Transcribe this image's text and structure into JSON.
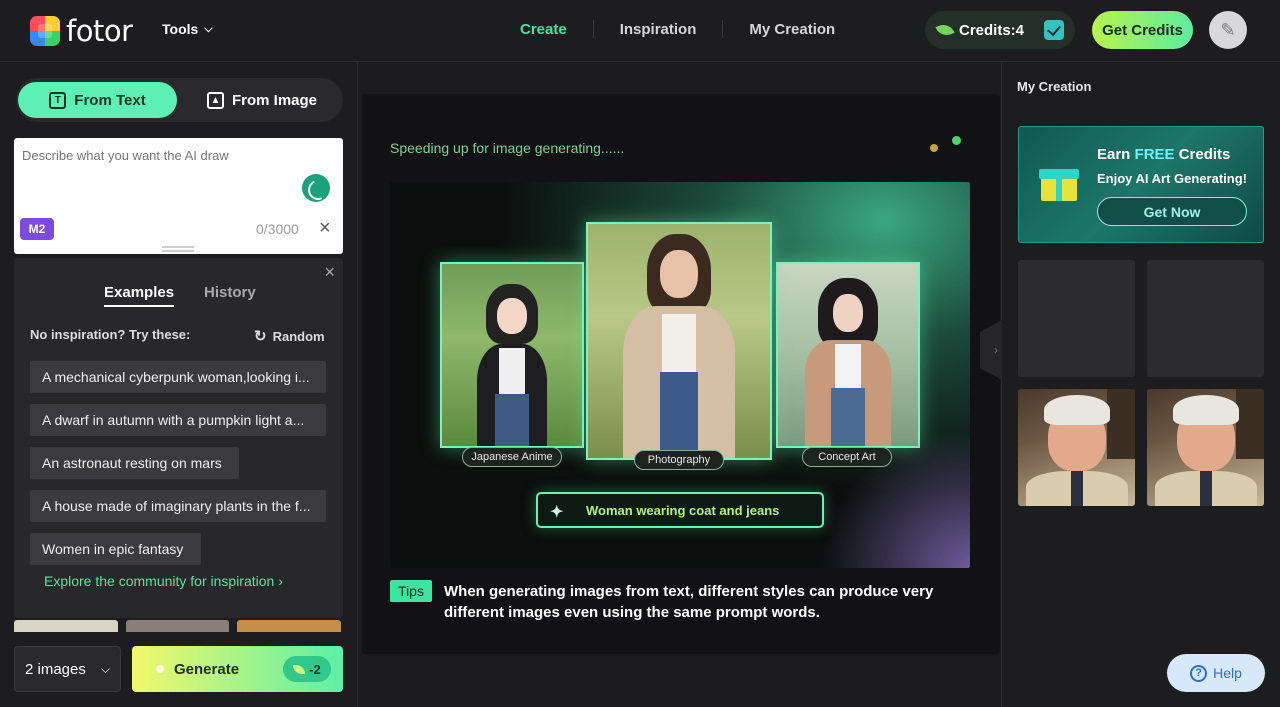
{
  "header": {
    "logo_text": "fotor",
    "tools_label": "Tools",
    "nav": [
      {
        "label": "Create",
        "active": true
      },
      {
        "label": "Inspiration",
        "active": false
      },
      {
        "label": "My Creation",
        "active": false
      }
    ],
    "credits_label": "Credits:4",
    "get_credits_label": "Get Credits"
  },
  "left_panel": {
    "mode_text_label": "From Text",
    "mode_image_label": "From Image",
    "prompt_placeholder": "Describe what you want the AI draw",
    "model_badge": "M2",
    "char_counter": "0/3000",
    "examples": {
      "tab_examples": "Examples",
      "tab_history": "History",
      "hint": "No inspiration? Try these:",
      "random_label": "Random",
      "items": [
        "A mechanical cyberpunk woman,looking i...",
        "A dwarf in autumn with a pumpkin light a...",
        "An astronaut resting on mars",
        "A house made of imaginary plants in the f...",
        "Women in epic fantasy"
      ],
      "explore_link": "Explore the community for inspiration"
    },
    "image_count": "2 images",
    "generate_label": "Generate",
    "generate_cost": "-2"
  },
  "center": {
    "status": "Speeding up for image generating......",
    "styles": [
      "Japanese Anime",
      "Photography",
      "Concept Art"
    ],
    "sample_prompt": "Woman wearing coat and jeans",
    "tips_badge": "Tips",
    "tips_text": "When generating images from text, different styles can produce very different images even using the same prompt words."
  },
  "right_panel": {
    "title": "My Creation",
    "promo": {
      "title_pre": "Earn",
      "title_free": "FREE",
      "title_post": "Credits",
      "subtitle": "Enjoy AI Art Generating!",
      "button": "Get Now"
    },
    "help_label": "Help"
  },
  "colors": {
    "accent_green": "#3ee6a3",
    "generate_gradient_start": "#f3f86a",
    "generate_gradient_end": "#5df0a8",
    "model_badge": "#7e4be0",
    "help_bg": "#d7e8fb"
  }
}
